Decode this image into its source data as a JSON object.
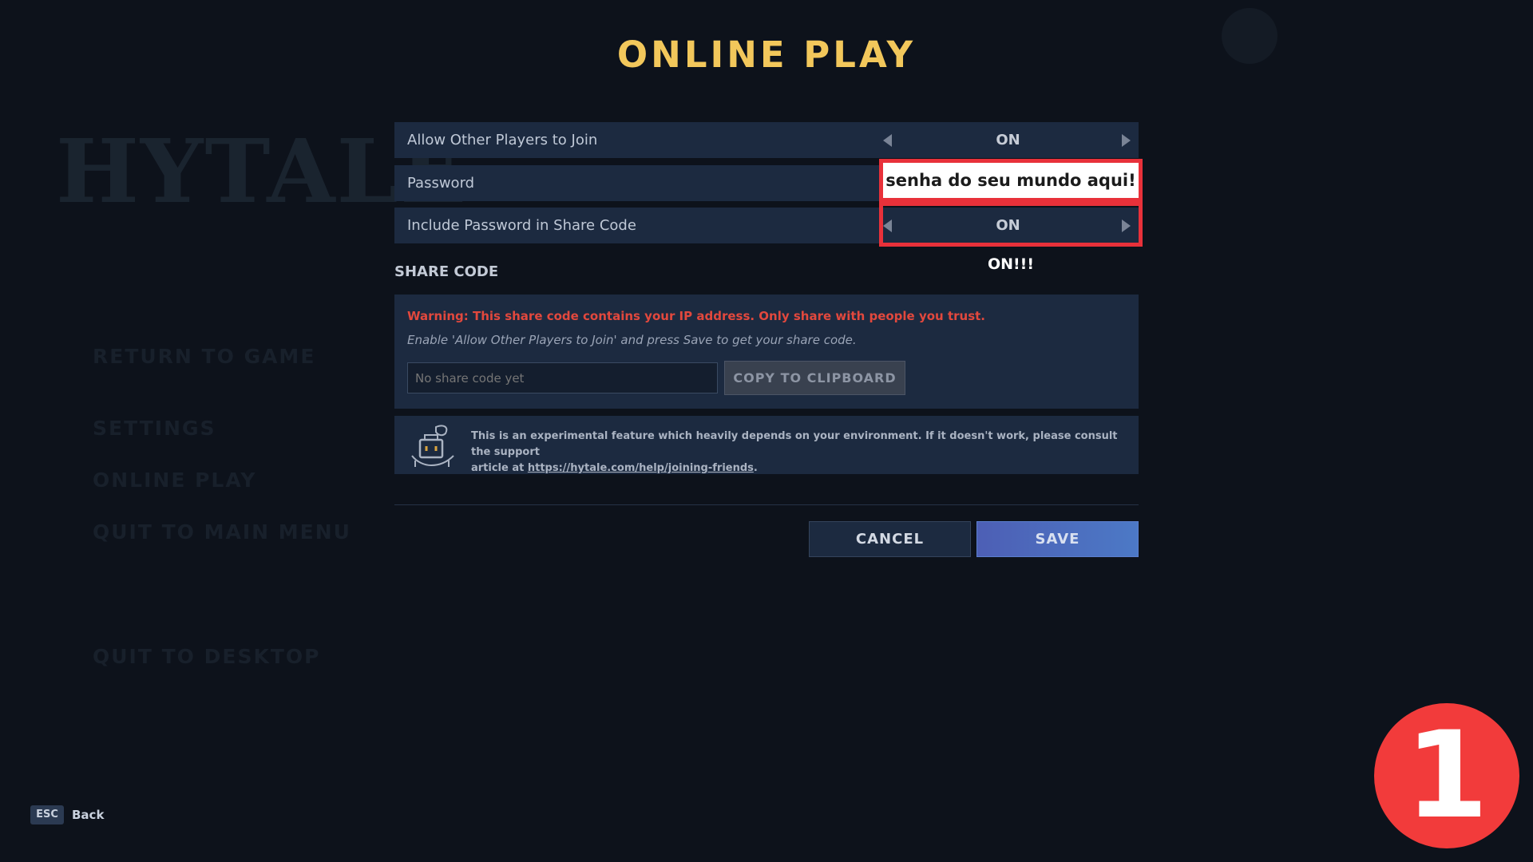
{
  "background_menu": {
    "logo_text": "HYTALE",
    "items": [
      "RETURN TO GAME",
      "SETTINGS",
      "ONLINE PLAY",
      "QUIT TO MAIN MENU",
      "QUIT TO DESKTOP"
    ]
  },
  "title": "ONLINE PLAY",
  "settings": {
    "allow_join": {
      "label": "Allow Other Players to Join",
      "value": "ON"
    },
    "password": {
      "label": "Password",
      "value": "senha do seu mundo aqui!"
    },
    "include_password": {
      "label": "Include Password in Share Code",
      "value": "ON"
    }
  },
  "annotation": {
    "on_note": "ON!!!",
    "step_number": "1"
  },
  "share_code": {
    "heading": "SHARE CODE",
    "warning": "Warning: This share code contains your IP address. Only share with people you trust.",
    "hint": "Enable 'Allow Other Players to Join' and press Save to get your share code.",
    "placeholder": "No share code yet",
    "copy_label": "COPY TO CLIPBOARD"
  },
  "info": {
    "text_line1": "This is an experimental feature which heavily depends on your environment. If it doesn't work, please consult the support",
    "text_prefix": "article at ",
    "link": "https://hytale.com/help/joining-friends",
    "text_suffix": "."
  },
  "buttons": {
    "cancel": "CANCEL",
    "save": "SAVE"
  },
  "footer": {
    "key": "ESC",
    "label": "Back"
  },
  "colors": {
    "background": "#0d121b",
    "panel": "#1c2a40",
    "title_gold": "#f2c75b",
    "warning_red": "#e2483d",
    "annotation_red": "#e8313a",
    "save_blue": "#4c6cc0"
  }
}
